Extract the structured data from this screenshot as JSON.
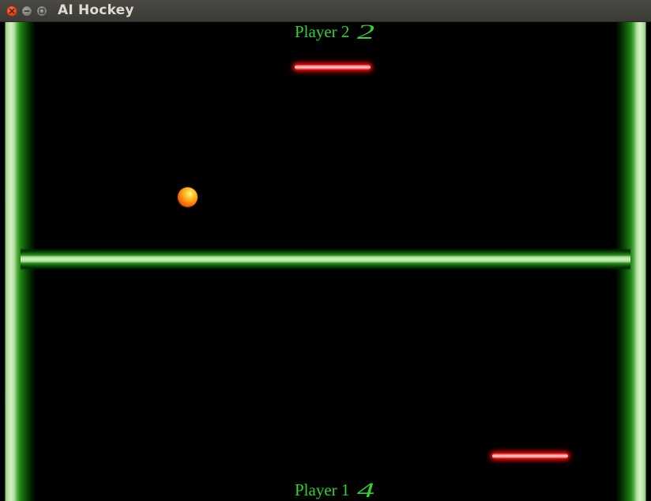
{
  "window": {
    "title": "AI Hockey",
    "buttons": {
      "close_icon": "close-icon",
      "minimize_icon": "minimize-icon",
      "maximize_icon": "maximize-icon"
    }
  },
  "game": {
    "player2": {
      "label": "Player 2",
      "score": "2"
    },
    "player1": {
      "label": "Player 1",
      "score": "4"
    }
  },
  "colors": {
    "background": "#000000",
    "walls": "#8fcf7e",
    "score_text": "#2fd42f",
    "paddle": "#ff2a2a",
    "puck": "#ff9a12"
  }
}
